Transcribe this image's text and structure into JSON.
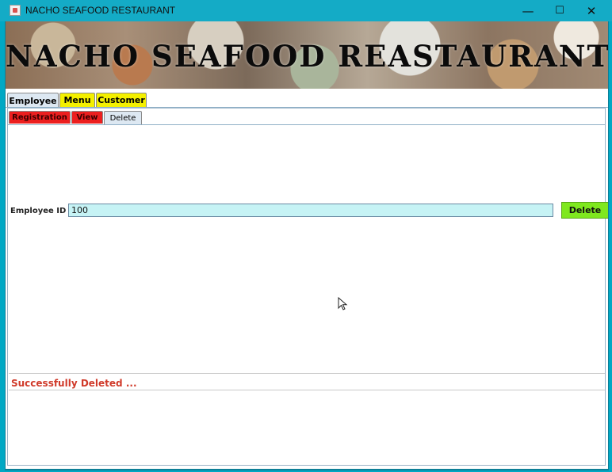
{
  "window": {
    "title": "NACHO SEAFOOD RESTAURANT",
    "controls": {
      "minimize": "—",
      "maximize": "☐",
      "close": "✕"
    }
  },
  "banner": {
    "title": "NACHO SEAFOOD REASTAURANT"
  },
  "main_tabs": [
    {
      "label": "Employee",
      "selected": true,
      "color": "#dde8f2"
    },
    {
      "label": "Menu",
      "selected": false,
      "color": "#f4f000"
    },
    {
      "label": "Customer",
      "selected": false,
      "color": "#f4f000"
    }
  ],
  "sub_tabs": [
    {
      "label": "Registration",
      "selected": false,
      "color": "#ec1f1f"
    },
    {
      "label": "View",
      "selected": false,
      "color": "#ec1f1f"
    },
    {
      "label": "Delete",
      "selected": true,
      "color": "#dde8f2"
    }
  ],
  "form": {
    "employee_id_label": "Employee ID :",
    "employee_id_value": "100",
    "delete_button": "Delete"
  },
  "status": {
    "message": "Successfully Deleted ...",
    "color": "#d03a2a"
  },
  "icons": {
    "app": "java-cup-icon",
    "cursor": "mouse-pointer-icon"
  }
}
